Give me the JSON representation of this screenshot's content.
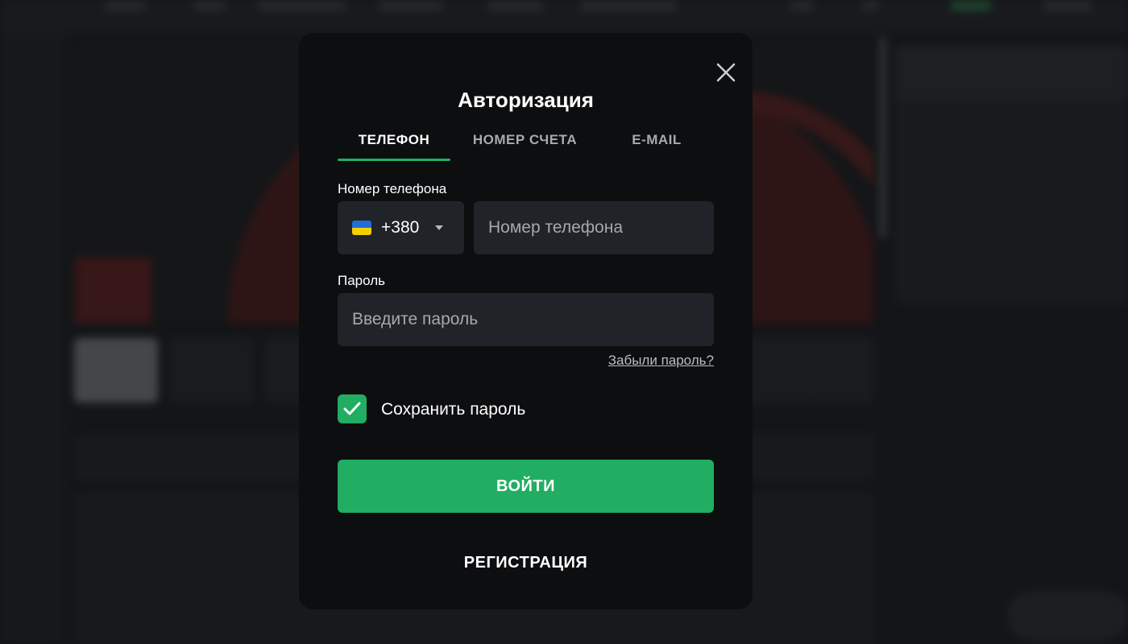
{
  "modal": {
    "title": "Авторизация",
    "tabs": [
      {
        "label": "ТЕЛЕФОН",
        "active": true
      },
      {
        "label": "НОМЕР СЧЕТА",
        "active": false
      },
      {
        "label": "E-MAIL",
        "active": false
      }
    ],
    "phone": {
      "label": "Номер телефона",
      "country_flag": "ukraine-flag-icon",
      "country_code": "+380",
      "placeholder": "Номер телефона",
      "value": ""
    },
    "password": {
      "label": "Пароль",
      "placeholder": "Введите пароль",
      "value": "",
      "forgot_link": "Забыли пароль?"
    },
    "remember": {
      "label": "Сохранить пароль",
      "checked": true
    },
    "login_button": "ВОЙТИ",
    "register_button": "РЕГИСТРАЦИЯ"
  },
  "colors": {
    "accent": "#21ae63",
    "modal_bg": "#0d0e10",
    "input_bg": "#202327",
    "inactive_tab": "#a7abaf"
  }
}
